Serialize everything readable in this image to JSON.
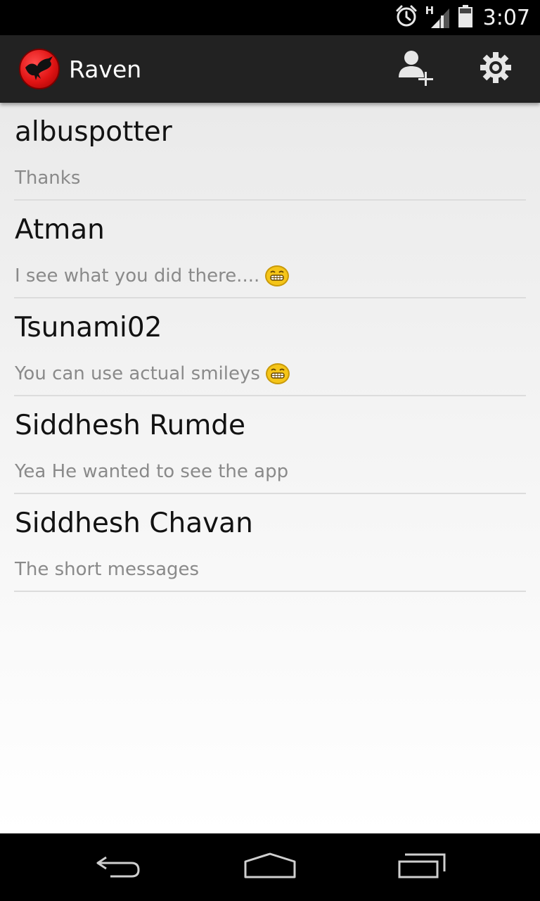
{
  "status_bar": {
    "time": "3:07",
    "network_label": "H",
    "icons": [
      "alarm-icon",
      "signal-icon",
      "battery-icon"
    ]
  },
  "action_bar": {
    "title": "Raven",
    "logo": "raven-logo",
    "actions": [
      "add-contact-icon",
      "settings-icon"
    ]
  },
  "conversations": [
    {
      "name": "albuspotter",
      "message": "Thanks",
      "emoji": false
    },
    {
      "name": "Atman",
      "message": "I see what you did there....",
      "emoji": true
    },
    {
      "name": "Tsunami02",
      "message": "You can use actual smileys",
      "emoji": true
    },
    {
      "name": "Siddhesh Rumde",
      "message": "Yea He wanted to see the app",
      "emoji": false
    },
    {
      "name": "Siddhesh Chavan",
      "message": "The short messages",
      "emoji": false
    }
  ],
  "nav_bar": [
    "back-icon",
    "home-icon",
    "recent-apps-icon"
  ],
  "colors": {
    "action_bar": "#222222",
    "status_bar": "#000000",
    "logo_red": "#e01414",
    "divider": "#dcdcdc",
    "name_text": "#121212",
    "message_text": "#8a8a8a",
    "emoji_yellow": "#f5c518"
  }
}
